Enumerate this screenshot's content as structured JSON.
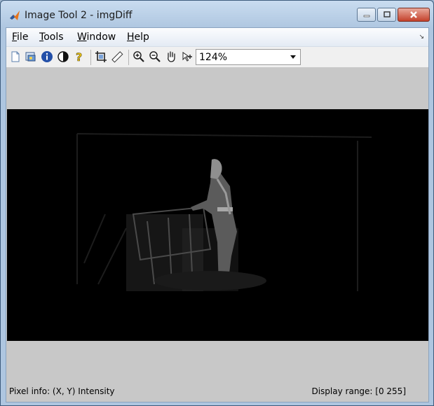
{
  "window": {
    "title": "Image Tool 2 - imgDiff",
    "controls": [
      "minimize-icon",
      "maximize-icon",
      "close-icon"
    ]
  },
  "menu": {
    "items": [
      {
        "accel": "F",
        "rest": "ile"
      },
      {
        "accel": "T",
        "rest": "ools"
      },
      {
        "accel": "W",
        "rest": "indow"
      },
      {
        "accel": "H",
        "rest": "elp"
      }
    ]
  },
  "toolbar": {
    "icons": [
      "new-figure-icon",
      "export-to-workspace-icon",
      "image-info-icon",
      "adjust-contrast-icon",
      "pixel-region-help-icon",
      "crop-icon",
      "measure-distance-icon",
      "zoom-in-icon",
      "zoom-out-icon",
      "pan-hand-icon",
      "data-cursor-icon"
    ],
    "zoom": {
      "value": "124%"
    }
  },
  "status": {
    "pixel_info": "Pixel info: (X, Y)  Intensity",
    "display_range": "Display range: [0 255]"
  },
  "colors": {
    "image_background": "#000000",
    "viewport_background": "#c8c8c8",
    "title_bar": "#c9dcf0",
    "close_button": "#c4412b"
  }
}
